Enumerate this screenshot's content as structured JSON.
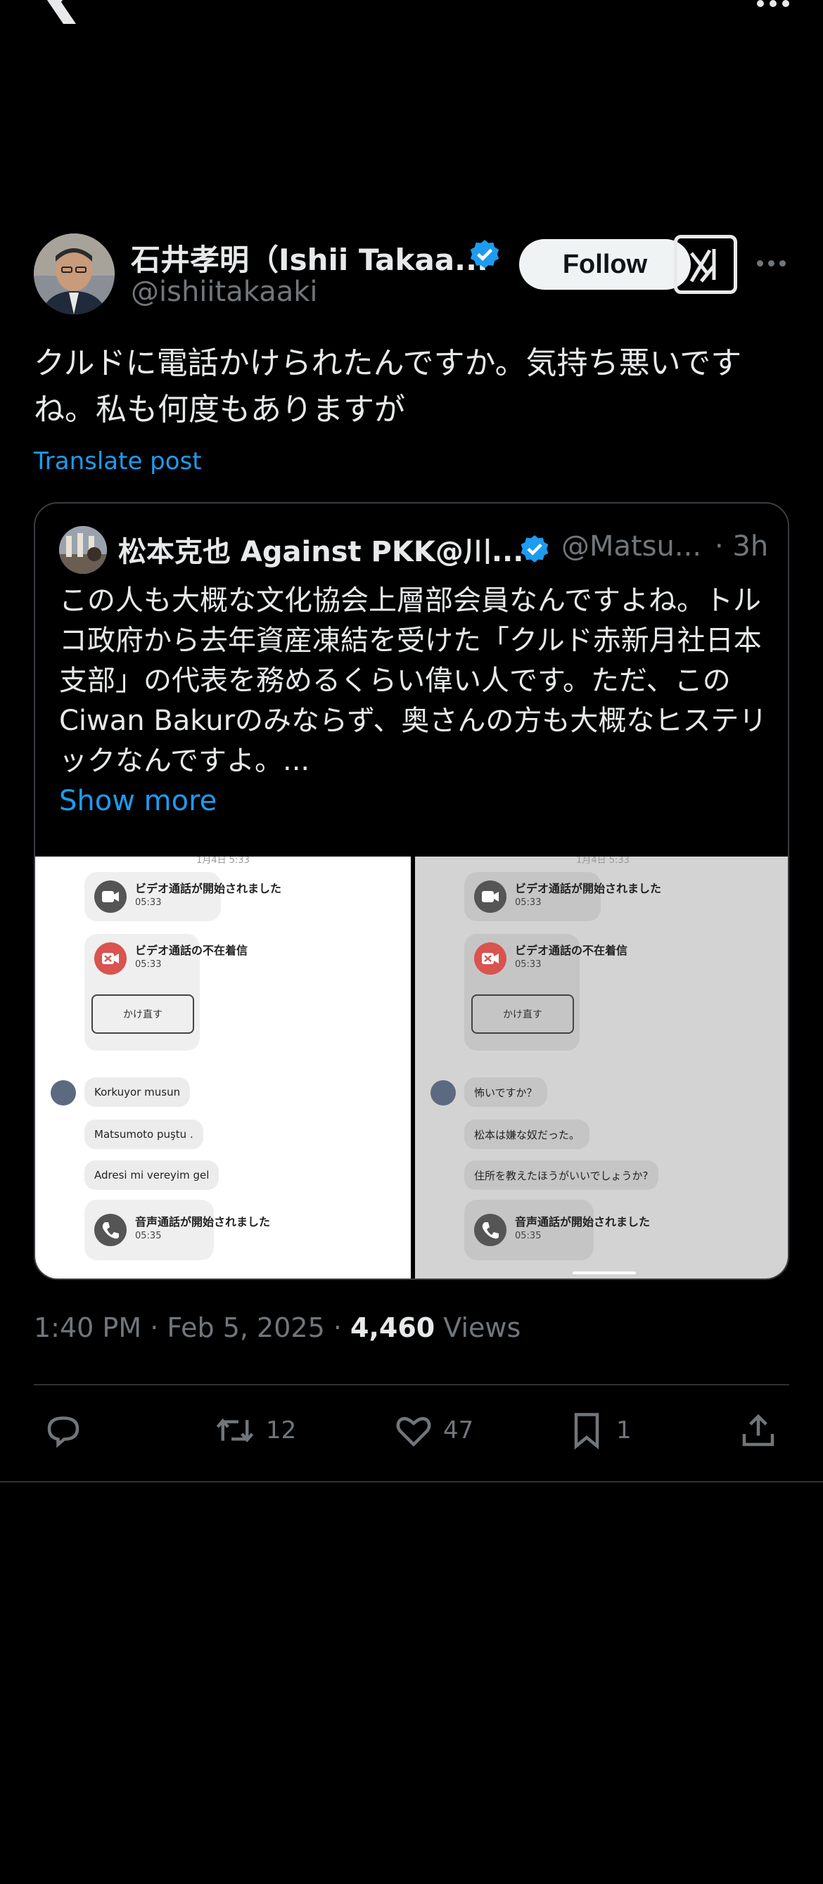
{
  "author": {
    "name": "石井孝明（Ishii Takaa...",
    "handle": "@ishiitakaaki",
    "follow_label": "Follow"
  },
  "tweet": {
    "text": "クルドに電話かけられたんですか。気持ち悪いですね。私も何度もありますが",
    "translate_label": "Translate post"
  },
  "quote": {
    "name": "松本克也 Against PKK@川...",
    "handle": "@Matsu...",
    "time": "· 3h",
    "text": "この人も大概な文化協会上層部会員なんですよね。トルコ政府から去年資産凍結を受けた「クルド赤新月社日本支部」の代表を務めるくらい偉い人です。ただ、このCiwan Bakurのみならず、奥さんの方も大概なヒステリックなんですよ。...",
    "show_more": "Show more"
  },
  "media": {
    "left": {
      "header": "1月4日 5:33",
      "video_started": "ビデオ通話が開始されました",
      "time1": "05:33",
      "missed": "ビデオ通話の不在着信",
      "time2": "05:33",
      "callback": "かけ直す",
      "msg1": "Korkuyor musun",
      "msg2": "Matsumoto puştu .",
      "msg3": "Adresi mi vereyim gel",
      "voice_started": "音声通話が開始されました",
      "time3": "05:35"
    },
    "right": {
      "header": "1月4日 5:33",
      "video_started": "ビデオ通話が開始されました",
      "time1": "05:33",
      "missed": "ビデオ通話の不在着信",
      "time2": "05:33",
      "callback": "かけ直す",
      "msg1": "怖いですか？",
      "msg2": "松本は嫌な奴だった。",
      "msg3": "住所を教えたほうがいいでしょうか?",
      "voice_started": "音声通話が開始されました",
      "time3": "05:35"
    }
  },
  "meta": {
    "time": "1:40 PM · Feb 5, 2025 · ",
    "views_count": "4,460",
    "views_label": " Views"
  },
  "actions": {
    "reposts": "12",
    "likes": "47",
    "bookmarks": "1"
  },
  "colors": {
    "background": "#000000",
    "accent": "#1d9bf0",
    "muted": "#71767b",
    "text": "#e7e9ea"
  }
}
